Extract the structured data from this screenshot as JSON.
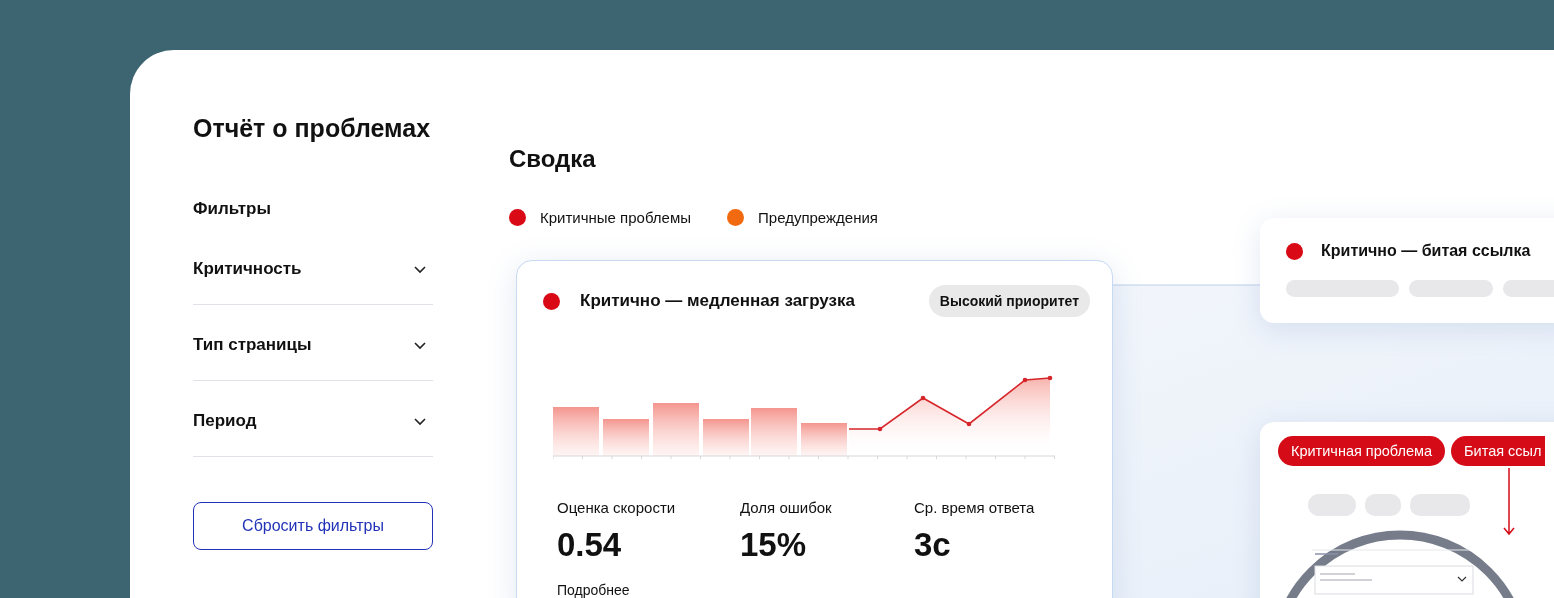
{
  "sidebar": {
    "title": "Отчёт о проблемах",
    "filters_heading": "Фильтры",
    "filters": [
      {
        "label": "Критичность",
        "expanded": false
      },
      {
        "label": "Тип страницы",
        "expanded": false
      },
      {
        "label": "Период",
        "expanded": false
      }
    ],
    "reset_button": "Сбросить фильтры"
  },
  "summary": {
    "title": "Сводка",
    "legend": [
      {
        "label": "Критичные проблемы",
        "color": "#d90a16"
      },
      {
        "label": "Предупреждения",
        "color": "#f26a10"
      }
    ],
    "issue_card": {
      "title": "Критично — медленная загрузка",
      "badge": "Высокий приоритет",
      "metrics": [
        {
          "label": "Оценка скорости",
          "value": "0.54"
        },
        {
          "label": "Доля ошибок",
          "value": "15%"
        },
        {
          "label": "Ср. время ответа",
          "value": "3с"
        }
      ],
      "link": "Подробнее"
    }
  },
  "side_card": {
    "title": "Критично — битая ссылка"
  },
  "preview_card": {
    "tags": [
      "Критичная проблема",
      "Битая ссыл"
    ]
  }
}
